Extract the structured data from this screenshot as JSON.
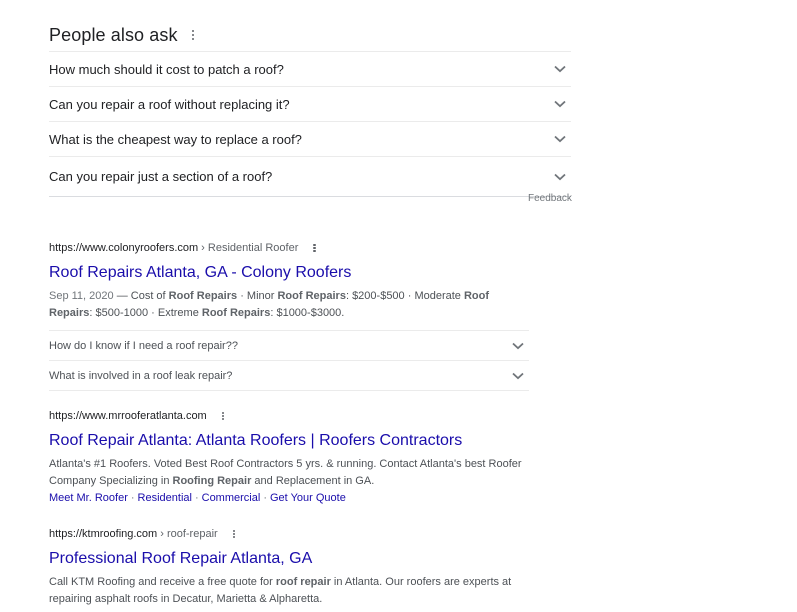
{
  "paa": {
    "title": "People also ask",
    "questions": [
      "How much should it cost to patch a roof?",
      "Can you repair a roof without replacing it?",
      "What is the cheapest way to replace a roof?",
      "Can you repair just a section of a roof?"
    ],
    "feedback": "Feedback"
  },
  "results": [
    {
      "url": "https://www.colonyroofers.com",
      "path": "› Residential Roofer",
      "title": "Roof Repairs Atlanta, GA - Colony Roofers",
      "snippet": {
        "date": "Sep 11, 2020",
        "parts": [
          " — Cost of ",
          "Roof Repairs",
          " · Minor ",
          "Roof Repairs",
          ": $200-$500 · Moderate ",
          "Roof Repairs",
          ": $500-1000 · Extreme ",
          "Roof Repairs",
          ": $1000-$3000."
        ]
      },
      "faqs": [
        "How do I know if I need a roof repair??",
        "What is involved in a roof leak repair?"
      ]
    },
    {
      "url": "https://www.mrrooferatlanta.com",
      "path": "",
      "title": "Roof Repair Atlanta: Atlanta Roofers | Roofers Contractors",
      "snippet": {
        "parts": [
          "Atlanta's #1 Roofers. Voted Best Roof Contractors 5 yrs. & running. Contact Atlanta's best Roofer Company Specializing in ",
          "Roofing Repair",
          " and Replacement in GA."
        ]
      },
      "sitelinks": [
        "Meet Mr. Roofer",
        "Residential",
        "Commercial",
        "Get Your Quote"
      ]
    },
    {
      "url": "https://ktmroofing.com",
      "path": "› roof-repair",
      "title": "Professional Roof Repair Atlanta, GA",
      "snippet": {
        "parts": [
          "Call KTM Roofing and receive a free quote for ",
          "roof repair",
          " in Atlanta. Our roofers are experts at repairing asphalt roofs in Decatur, Marietta & Alpharetta."
        ]
      }
    }
  ],
  "colors": {
    "link": "#1a0dab",
    "text": "#202124",
    "snippet": "#4d5156",
    "muted": "#70757a",
    "divider": "#ebebeb"
  },
  "icons": {
    "more": "kebab-menu-icon",
    "expand": "chevron-down-icon"
  }
}
